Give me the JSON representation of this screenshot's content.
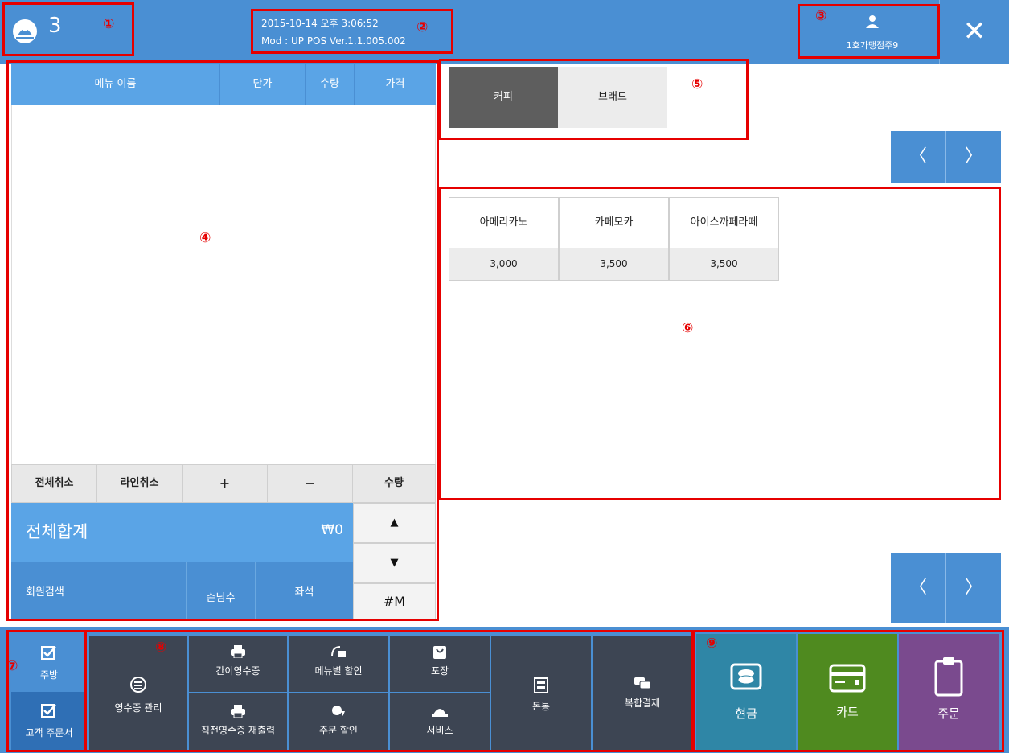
{
  "header": {
    "table_number": "3",
    "datetime": "2015-10-14 오후 3:06:52",
    "version": "Mod : UP POS Ver.1.1.005.002",
    "user_name": "1호가맹점주9",
    "close_symbol": "✕",
    "icons": {
      "logo": "pos-logo-icon",
      "user": "user-icon",
      "close": "close-icon"
    }
  },
  "order_table": {
    "columns": [
      "메뉴 이름",
      "단가",
      "수량",
      "가격"
    ],
    "rows": []
  },
  "controls": {
    "cancel_all": "전체취소",
    "cancel_line": "라인취소",
    "plus": "+",
    "minus": "−",
    "quantity": "수량",
    "up": "▲",
    "down": "▼",
    "hash_m": "#M"
  },
  "total": {
    "label": "전체합계",
    "value": "₩0"
  },
  "member": {
    "search": "회원검색",
    "guests": "손님수",
    "seat": "좌석"
  },
  "categories": [
    {
      "label": "커피",
      "selected": true
    },
    {
      "label": "브래드",
      "selected": false
    }
  ],
  "nav": {
    "prev": "〈",
    "next": "〉"
  },
  "menu_items": [
    {
      "name": "아메리카노",
      "price": "3,000"
    },
    {
      "name": "카페모카",
      "price": "3,500"
    },
    {
      "name": "아이스까페라떼",
      "price": "3,500"
    }
  ],
  "bottom_left": [
    {
      "label": "주방",
      "icon": "checkbox-icon"
    },
    {
      "label": "고객 주문서",
      "icon": "checkbox-icon"
    }
  ],
  "functions": {
    "receipt_mgmt": "영수증 관리",
    "simple_receipt": "간이영수증",
    "reprint_last": "직전영수증 재출력",
    "menu_discount": "메뉴별 할인",
    "order_discount": "주문 할인",
    "packing": "포장",
    "service": "서비스",
    "cash_drawer": "돈통",
    "split_pay": "복합결제"
  },
  "payments": [
    {
      "label": "현금",
      "color": "#2f86a6",
      "icon": "cash-icon"
    },
    {
      "label": "카드",
      "color": "#4f8a1f",
      "icon": "card-icon"
    },
    {
      "label": "주문",
      "color": "#7a4a8e",
      "icon": "clipboard-icon"
    }
  ],
  "annotations": [
    "①",
    "②",
    "③",
    "④",
    "⑤",
    "⑥",
    "⑦",
    "⑧",
    "⑨"
  ],
  "colors": {
    "header": "#4a8fd3",
    "accent": "#5aa4e6",
    "highlight_box": "#e60000",
    "dark_btn": "#3d4553"
  }
}
